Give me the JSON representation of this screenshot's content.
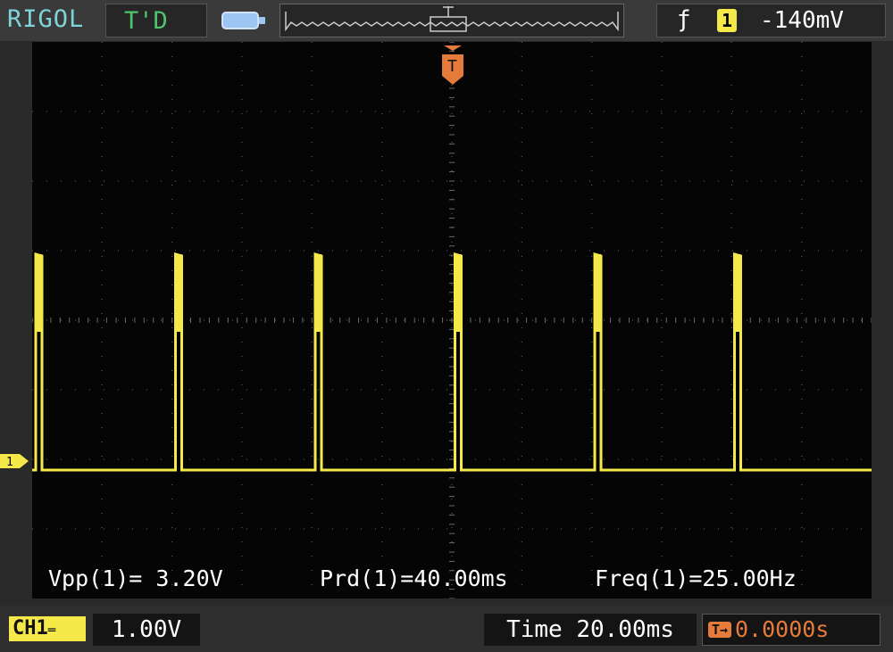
{
  "header": {
    "brand": "RIGOL",
    "run_status": "T'D",
    "trigger_edge_symbol": "ƒ",
    "trigger_channel": "1",
    "trigger_level": "-140mV"
  },
  "trace": {
    "color": "#f5e94a",
    "channel_marker": "1",
    "pulse_count": 6
  },
  "trigger_marker": {
    "label": "T",
    "color": "#e57b3a"
  },
  "measurements": [
    {
      "label": "Vpp(1)",
      "text": "Vpp(1)= 3.20V"
    },
    {
      "label": "Prd(1)",
      "text": "Prd(1)=40.00ms"
    },
    {
      "label": "Freq(1)",
      "text": "Freq(1)=25.00Hz"
    }
  ],
  "footer": {
    "channel_label": "CH1",
    "volts_per_div": "1.00V",
    "time_per_div": "Time 20.00ms",
    "trigger_offset": "0.0000s"
  },
  "colors": {
    "accent": "#f5e94a",
    "trigger": "#e57b3a",
    "brand": "#7fd4d8",
    "status": "#4fc46a"
  }
}
